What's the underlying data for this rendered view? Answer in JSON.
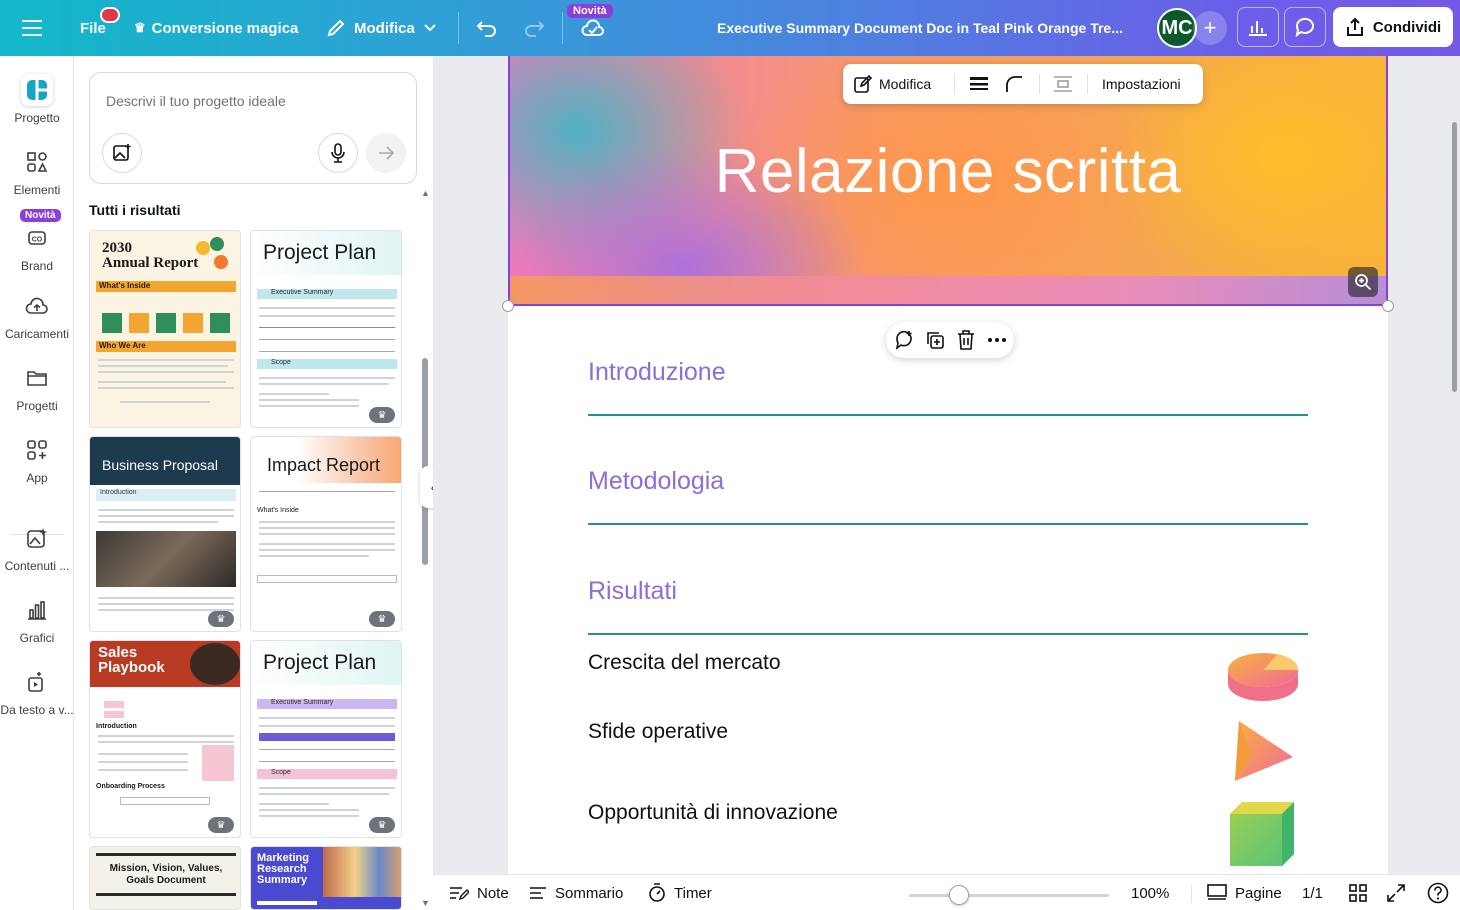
{
  "topbar": {
    "file_label": "File",
    "magic_label": "Conversione magica",
    "edit_label": "Modifica",
    "novita_badge": "Novità",
    "doc_title": "Executive Summary Document Doc in Teal Pink Orange Tre...",
    "avatar_initials": "MC",
    "share_label": "Condividi"
  },
  "rail": {
    "items": [
      {
        "label": "Progetto",
        "icon": "layout-icon"
      },
      {
        "label": "Elementi",
        "icon": "shapes-icon"
      },
      {
        "label": "Brand",
        "icon": "brand-icon"
      },
      {
        "label": "Caricamenti",
        "icon": "upload-cloud-icon"
      },
      {
        "label": "Progetti",
        "icon": "folder-icon"
      },
      {
        "label": "App",
        "icon": "apps-icon"
      },
      {
        "label": "Contenuti ...",
        "icon": "magic-media-icon"
      },
      {
        "label": "Grafici",
        "icon": "chart-icon"
      },
      {
        "label": "Da testo a v...",
        "icon": "text-to-video-icon"
      }
    ],
    "novita_badge": "Novità"
  },
  "panel": {
    "prompt_placeholder": "Descrivi il tuo progetto ideale",
    "results_title": "Tutti i risultati",
    "templates": [
      {
        "title_line1": "2030",
        "title_line2": "Annual Report",
        "sub1": "What's Inside",
        "sub2": "Who We Are"
      },
      {
        "title": "Project Plan",
        "sub1": "Executive Summary",
        "sub2": "Scope"
      },
      {
        "title": "Business Proposal",
        "sub1": "Introduction"
      },
      {
        "title": "Impact Report",
        "sub1": "What's Inside"
      },
      {
        "title_line1": "Sales",
        "title_line2": "Playbook",
        "sub1": "Introduction",
        "sub2": "Onboarding Process"
      },
      {
        "title": "Project Plan",
        "sub1": "Executive Summary",
        "sub2": "Scope"
      },
      {
        "title_line1": "Mission, Vision, Values,",
        "title_line2": "Goals Document"
      },
      {
        "title_line1": "Marketing",
        "title_line2": "Research",
        "title_line3": "Summary"
      }
    ]
  },
  "canvas": {
    "hero_title": "Relazione scritta",
    "float_toolbar": {
      "edit_label": "Modifica",
      "settings_label": "Impostazioni"
    },
    "sections": [
      "Introduzione",
      "Metodologia",
      "Risultati"
    ],
    "subitems": [
      "Crescita del mercato",
      "Sfide operative",
      "Opportunità di innovazione"
    ]
  },
  "bottombar": {
    "notes_label": "Note",
    "summary_label": "Sommario",
    "timer_label": "Timer",
    "zoom_percent": "100%",
    "zoom_level": 0.25,
    "pages_label": "Pagine",
    "page_count": "1/1"
  },
  "colors": {
    "accent": "#8b3fd9",
    "section_heading": "#8a6fd6",
    "section_rule": "#2a8c8c"
  }
}
